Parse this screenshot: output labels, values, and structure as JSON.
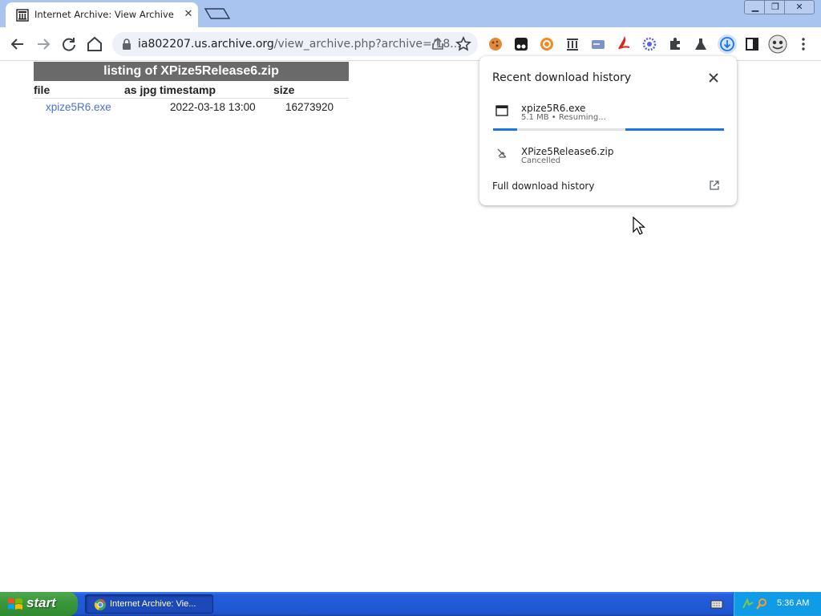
{
  "browser": {
    "tab": {
      "title": "Internet Archive: View Archive",
      "close_glyph": "✕",
      "favicon": "archive-building-icon"
    },
    "window_controls": {
      "minimize": "▁",
      "maximize": "❐",
      "close": "✕"
    },
    "omnibox": {
      "url_host": "ia802207.us.archive.org",
      "url_path": "/view_archive.php?archive=/18..."
    },
    "extensions": [
      "cookie-extension-icon",
      "tampermonkey-icon",
      "orange-circle-icon",
      "archive-building-icon",
      "card-icon",
      "acrobat-icon",
      "gear-flower-icon",
      "puzzle-icon",
      "flask-icon",
      "download-icon",
      "side-panel-icon",
      "profile-avatar-icon"
    ]
  },
  "page": {
    "listing_title": "listing of XPize5Release6.zip",
    "headers": {
      "file": "file",
      "as_jpg": "as jpg",
      "timestamp": "timestamp",
      "size": "size"
    },
    "rows": [
      {
        "file": "xpize5R6.exe",
        "timestamp": "2022-03-18 13:00",
        "size": "16273920"
      }
    ]
  },
  "download_bubble": {
    "title": "Recent download history",
    "items": [
      {
        "name": "xpize5R6.exe",
        "status": "5.1 MB • Resuming..."
      },
      {
        "name": "XPize5Release6.zip",
        "status": "Cancelled"
      }
    ],
    "footer_link": "Full download history"
  },
  "taskbar": {
    "start_label": "start",
    "task_button": "Internet Archive: Vie...",
    "clock": "5:36 AM"
  },
  "colors": {
    "tabstrip": "#a9c4ef",
    "link": "#4a6fd0",
    "progress": "#1a73e8",
    "taskbar": "#245edb",
    "start_button": "#3b973b"
  }
}
